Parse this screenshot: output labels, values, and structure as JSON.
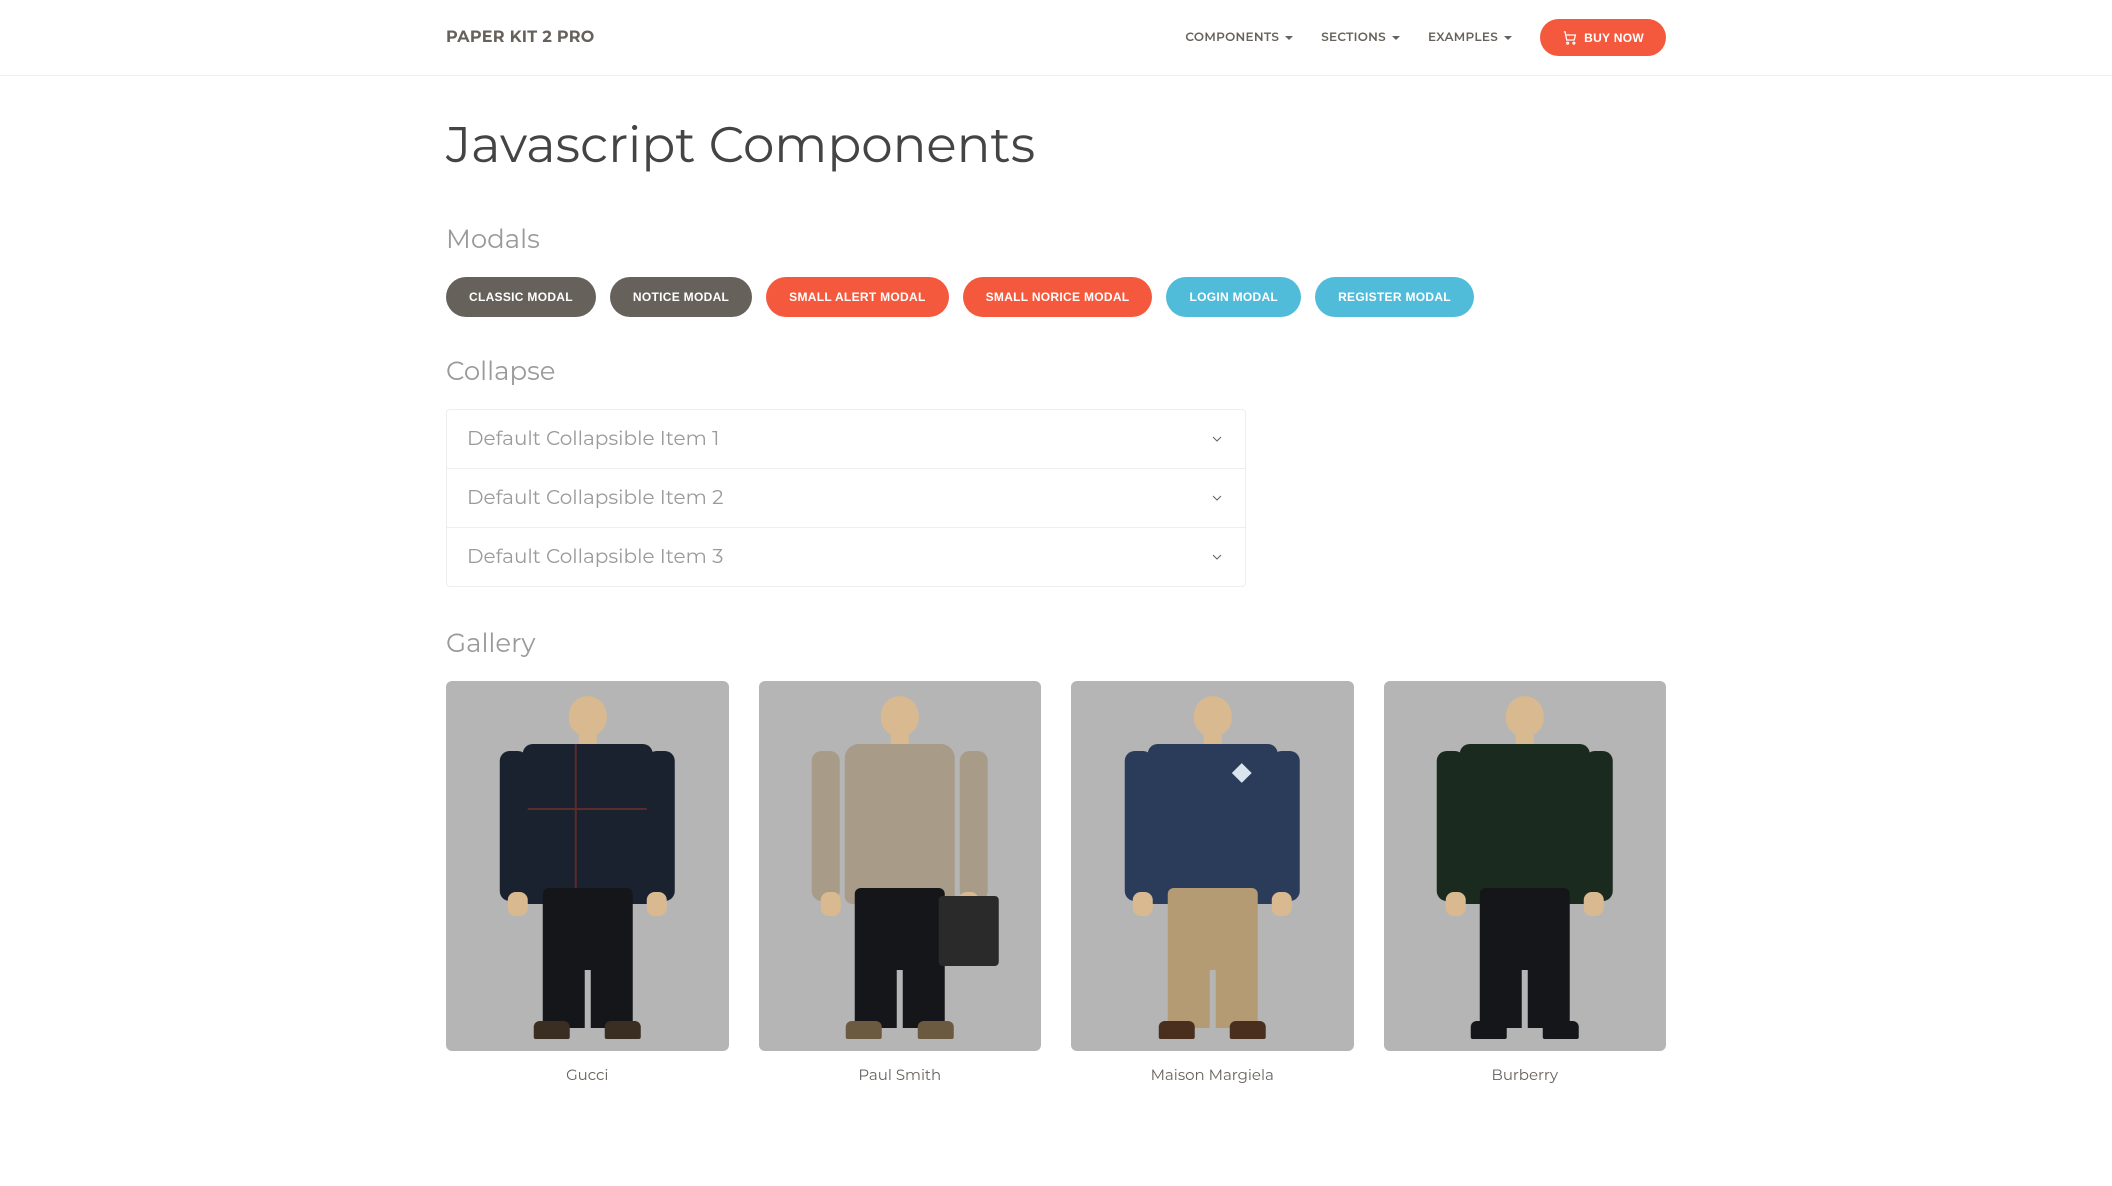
{
  "navbar": {
    "brand": "PAPER KIT 2 PRO",
    "links": [
      {
        "label": "COMPONENTS"
      },
      {
        "label": "SECTIONS"
      },
      {
        "label": "EXAMPLES"
      }
    ],
    "buy_label": "BUY NOW"
  },
  "page_title": "Javascript Components",
  "sections": {
    "modals": {
      "title": "Modals",
      "buttons": [
        {
          "label": "CLASSIC MODAL",
          "variant": "default"
        },
        {
          "label": "NOTICE MODAL",
          "variant": "default"
        },
        {
          "label": "SMALL ALERT MODAL",
          "variant": "danger"
        },
        {
          "label": "SMALL NORICE MODAL",
          "variant": "danger"
        },
        {
          "label": "LOGIN MODAL",
          "variant": "info"
        },
        {
          "label": "REGISTER MODAL",
          "variant": "info"
        }
      ]
    },
    "collapse": {
      "title": "Collapse",
      "items": [
        {
          "label": "Default Collapsible Item 1"
        },
        {
          "label": "Default Collapsible Item 2"
        },
        {
          "label": "Default Collapsible Item 3"
        }
      ]
    },
    "gallery": {
      "title": "Gallery",
      "items": [
        {
          "caption": "Gucci"
        },
        {
          "caption": "Paul Smith"
        },
        {
          "caption": "Maison Margiela"
        },
        {
          "caption": "Burberry"
        }
      ]
    }
  }
}
